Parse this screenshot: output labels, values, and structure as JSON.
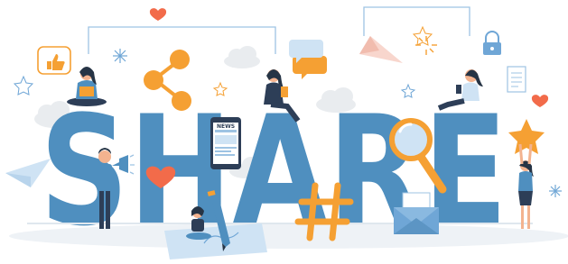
{
  "illustration": {
    "headline": "SHARE",
    "phone_label": "NEWS",
    "colors": {
      "letters": "#4f8fbf",
      "letters_shadow": "#3f7aa6",
      "accent_orange": "#f5a033",
      "heart": "#f26b4a",
      "light_blue": "#cfe3f4",
      "cloud": "#e9ecef",
      "skin": "#f3b38f",
      "dark_hair": "#263445",
      "dark_navy": "#2d3e57"
    },
    "icons": [
      "like-icon",
      "share-network-icon",
      "chat-bubble-icon",
      "paper-plane-icon",
      "lock-icon",
      "document-icon",
      "heart-icon",
      "star-icon",
      "magnifier-icon",
      "hashtag-icon",
      "envelope-icon",
      "megaphone-icon",
      "pencil-icon",
      "phone-icon",
      "cloud-icon"
    ]
  }
}
